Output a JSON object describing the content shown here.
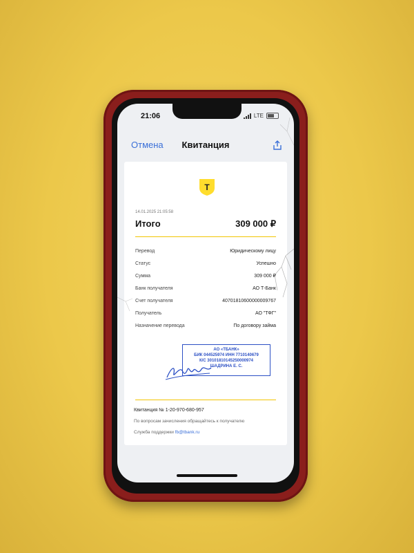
{
  "status_bar": {
    "time": "21:06",
    "network": "LTE"
  },
  "nav": {
    "cancel_label": "Отмена",
    "title": "Квитанция",
    "share_icon": "share-icon"
  },
  "receipt": {
    "logo_letter": "Т",
    "datetime": "14.01.2025 21:05:58",
    "total_label": "Итого",
    "total_value": "309 000 ₽",
    "rows": [
      {
        "label": "Перевод",
        "value": "Юридическому лицу"
      },
      {
        "label": "Статус",
        "value": "Успешно"
      },
      {
        "label": "Сумма",
        "value": "309 000 ₽"
      },
      {
        "label": "Банк получателя",
        "value": "АО Т-Банк"
      },
      {
        "label": "Счет получателя",
        "value": "40701810600000009767"
      },
      {
        "label": "Получатель",
        "value": "АО \"ТФГ\""
      },
      {
        "label": "Назначение перевода",
        "value": "По договору займа"
      }
    ],
    "stamp": {
      "line1": "АО «ТБАНК»",
      "line2": "БИК 044525974 ИНН 7710140679",
      "line3": "К/С 30101810145250000974",
      "line4": "ШАДРИНА Е. С."
    },
    "receipt_number": "Квитанция № 1-20-970-680-957",
    "note": "По вопросам зачисления обращайтесь к получателю",
    "support_label": "Служба поддержки",
    "support_email": "fb@tbank.ru"
  },
  "colors": {
    "accent": "#3a6fd8",
    "brand_yellow": "#ffdd2d",
    "stamp_blue": "#2b4fc4",
    "case_red": "#8a1e1c"
  }
}
